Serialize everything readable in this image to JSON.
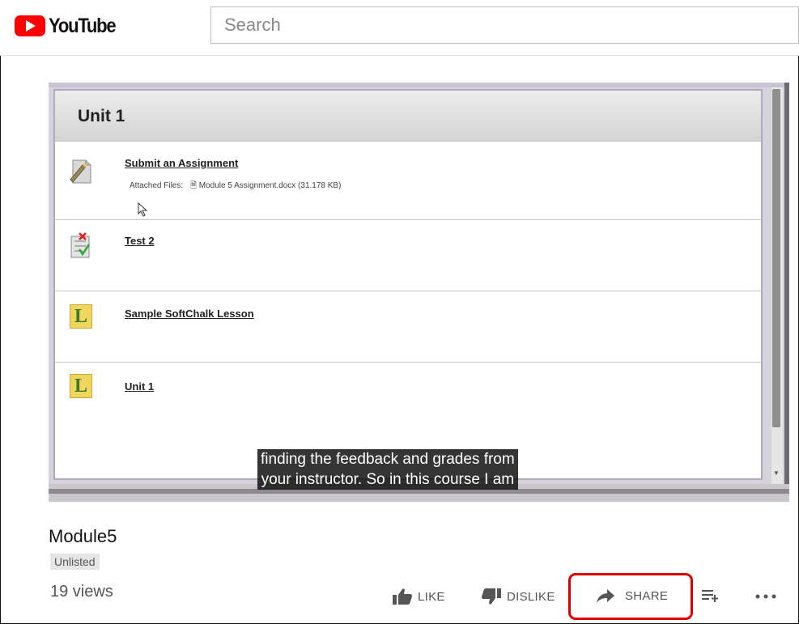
{
  "header": {
    "logo_text": "YouTube",
    "search_placeholder": "Search"
  },
  "video": {
    "unit_title": "Unit 1",
    "items": [
      {
        "label": "Submit an Assignment",
        "icon": "assignment-icon",
        "attached_label": "Attached Files:",
        "attached_file": "Module 5 Assignment.docx (31.178 KB)"
      },
      {
        "label": "Test 2",
        "icon": "test-icon"
      },
      {
        "label": "Sample SoftChalk Lesson",
        "icon": "lesson-icon",
        "icon_letter": "L"
      },
      {
        "label": "Unit 1",
        "icon": "lesson-icon",
        "icon_letter": "L"
      }
    ],
    "caption_line1": "finding the feedback and grades from",
    "caption_line2": "your instructor. So in this course I am"
  },
  "info": {
    "title": "Module5",
    "badge": "Unlisted",
    "views": "19 views"
  },
  "actions": {
    "like": "LIKE",
    "dislike": "DISLIKE",
    "share": "SHARE"
  },
  "colors": {
    "brand_red": "#ff0000",
    "highlight": "#e00000"
  }
}
